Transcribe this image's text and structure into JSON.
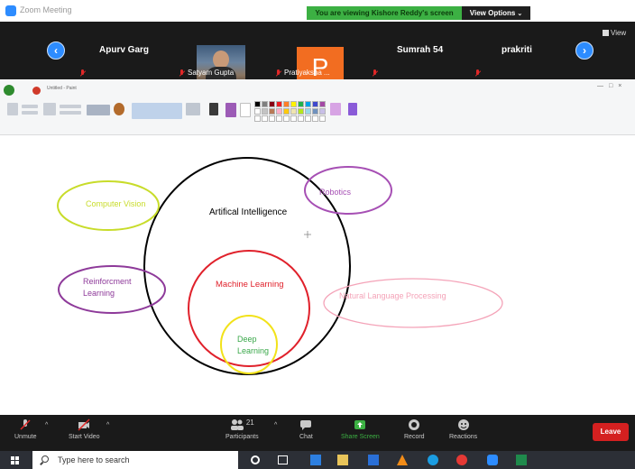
{
  "window": {
    "title": "Zoom Meeting"
  },
  "share": {
    "banner": "You are viewing Kishore Reddy's screen",
    "view_options": "View Options",
    "view_toggle": "View"
  },
  "participants": [
    {
      "name": "Apurv Garg"
    },
    {
      "name": "Satyam Gupta"
    },
    {
      "name": "Pratiyaksha ..."
    },
    {
      "name": "Sumrah 54"
    },
    {
      "name": "prakriti"
    }
  ],
  "avatar_initial": "P",
  "paint": {
    "title": "Untitled - Paint"
  },
  "diagram": {
    "labels": {
      "ai": "Artifical Intelligence",
      "cv": "Computer Vision",
      "robotics": "Robotics",
      "rl": "Reinforcment Learning",
      "ml": "Machine Learning",
      "nlp": "Natural Language Processing",
      "dl": "Deep Learning"
    },
    "colors": {
      "ai": "#000000",
      "cv": "#c8dc2a",
      "robotics": "#a64fb4",
      "rl": "#8e3a9a",
      "ml": "#e0212b",
      "nlp": "#f4a3b8",
      "dl": "#f2e21a",
      "dl_text": "#3aa84a"
    }
  },
  "toolbar": {
    "unmute": "Unmute",
    "start_video": "Start Video",
    "participants": "Participants",
    "participant_count": "21",
    "chat": "Chat",
    "share_screen": "Share Screen",
    "record": "Record",
    "reactions": "Reactions",
    "leave": "Leave"
  },
  "taskbar": {
    "search_placeholder": "Type here to search"
  }
}
